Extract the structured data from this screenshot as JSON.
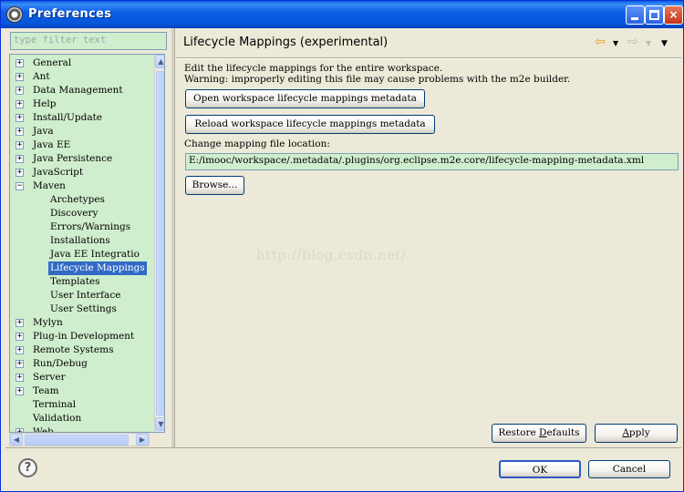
{
  "window": {
    "title": "Preferences",
    "minimize_label": "",
    "maximize_label": "",
    "close_label": "×"
  },
  "left": {
    "filter_placeholder": "type filter text",
    "tree": [
      {
        "label": "General",
        "level": 0,
        "expander": "+"
      },
      {
        "label": "Ant",
        "level": 0,
        "expander": "+"
      },
      {
        "label": "Data Management",
        "level": 0,
        "expander": "+"
      },
      {
        "label": "Help",
        "level": 0,
        "expander": "+"
      },
      {
        "label": "Install/Update",
        "level": 0,
        "expander": "+"
      },
      {
        "label": "Java",
        "level": 0,
        "expander": "+"
      },
      {
        "label": "Java EE",
        "level": 0,
        "expander": "+"
      },
      {
        "label": "Java Persistence",
        "level": 0,
        "expander": "+"
      },
      {
        "label": "JavaScript",
        "level": 0,
        "expander": "+"
      },
      {
        "label": "Maven",
        "level": 0,
        "expander": "−"
      },
      {
        "label": "Archetypes",
        "level": 1,
        "expander": ""
      },
      {
        "label": "Discovery",
        "level": 1,
        "expander": ""
      },
      {
        "label": "Errors/Warnings",
        "level": 1,
        "expander": ""
      },
      {
        "label": "Installations",
        "level": 1,
        "expander": ""
      },
      {
        "label": "Java EE Integratio",
        "level": 1,
        "expander": ""
      },
      {
        "label": "Lifecycle Mappings",
        "level": 1,
        "expander": "",
        "selected": true
      },
      {
        "label": "Templates",
        "level": 1,
        "expander": ""
      },
      {
        "label": "User Interface",
        "level": 1,
        "expander": ""
      },
      {
        "label": "User Settings",
        "level": 1,
        "expander": ""
      },
      {
        "label": "Mylyn",
        "level": 0,
        "expander": "+"
      },
      {
        "label": "Plug-in Development",
        "level": 0,
        "expander": "+"
      },
      {
        "label": "Remote Systems",
        "level": 0,
        "expander": "+"
      },
      {
        "label": "Run/Debug",
        "level": 0,
        "expander": "+"
      },
      {
        "label": "Server",
        "level": 0,
        "expander": "+"
      },
      {
        "label": "Team",
        "level": 0,
        "expander": "+"
      },
      {
        "label": "Terminal",
        "level": 0,
        "expander": ""
      },
      {
        "label": "Validation",
        "level": 0,
        "expander": ""
      },
      {
        "label": "Web",
        "level": 0,
        "expander": "+"
      }
    ]
  },
  "page": {
    "title": "Lifecycle Mappings (experimental)",
    "description_line1": "Edit the lifecycle mappings for the entire workspace.",
    "description_line2": "Warning: improperly editing this file may cause problems with the m2e builder.",
    "open_button": "Open workspace lifecycle mappings metadata",
    "reload_button": "Reload workspace lifecycle mappings metadata",
    "change_label": "Change mapping file location:",
    "path_value": "E:/imooc/workspace/.metadata/.plugins/org.eclipse.m2e.core/lifecycle-mapping-metadata.xml",
    "browse_button": "Browse...",
    "watermark": "http://blog.csdn.net/",
    "restore_prefix": "Restore ",
    "restore_underlined": "D",
    "restore_suffix": "efaults",
    "apply_underlined": "A",
    "apply_suffix": "pply",
    "nav_back": "⇦",
    "nav_forward": "⇨",
    "dropdown": "▼"
  },
  "footer": {
    "help": "?",
    "ok": "OK",
    "cancel": "Cancel"
  },
  "colors": {
    "tree_background": "#cfeecd",
    "selection": "#316ac5",
    "titlebar": "#0554d8"
  }
}
